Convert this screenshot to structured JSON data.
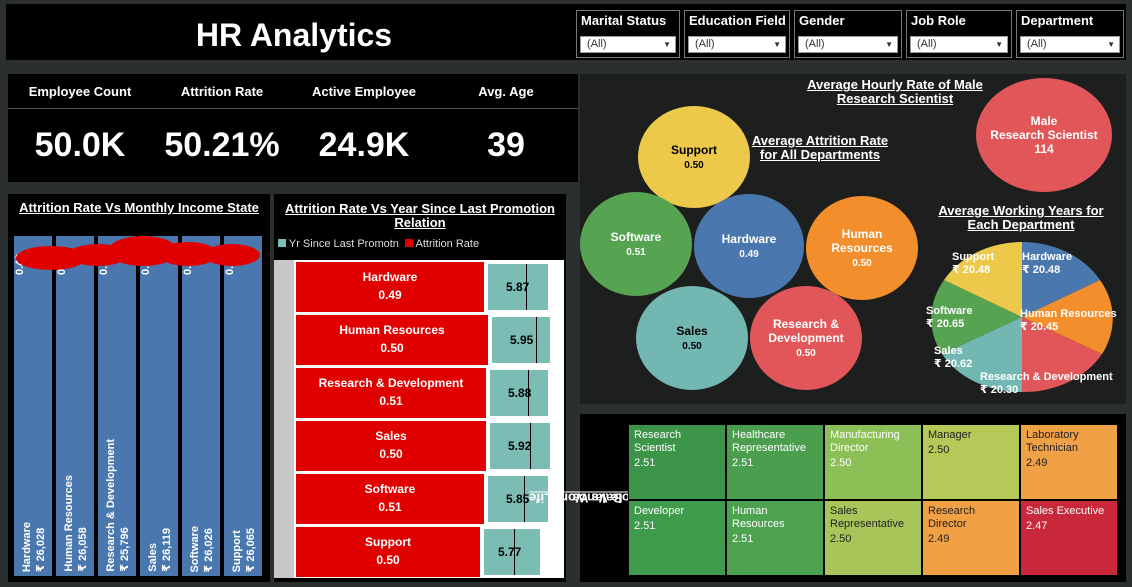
{
  "title": "HR Analytics",
  "filters": [
    {
      "label": "Marital Status",
      "value": "(All)"
    },
    {
      "label": "Education Field",
      "value": "(All)"
    },
    {
      "label": "Gender",
      "value": "(All)"
    },
    {
      "label": "Job Role",
      "value": "(All)"
    },
    {
      "label": "Department",
      "value": "(All)"
    }
  ],
  "kpis": [
    {
      "label": "Employee Count",
      "value": "50.0K"
    },
    {
      "label": "Attrition Rate",
      "value": "50.21%"
    },
    {
      "label": "Active Employee",
      "value": "24.9K"
    },
    {
      "label": "Avg. Age",
      "value": "39"
    }
  ],
  "income_chart": {
    "title": "Attrition Rate Vs Monthly Income State",
    "bars": [
      {
        "category": "Hardware",
        "income": "₹ 26,028",
        "rate": "0.49"
      },
      {
        "category": "Human Resources",
        "income": "₹ 26,058",
        "rate": "0.50"
      },
      {
        "category": "Research & Development",
        "income": "₹ 25,796",
        "rate": "0.51"
      },
      {
        "category": "Sales",
        "income": "₹ 26,119",
        "rate": "0.50"
      },
      {
        "category": "Software",
        "income": "₹ 26,026",
        "rate": "0.51"
      },
      {
        "category": "Support",
        "income": "₹ 26,065",
        "rate": "0.50"
      }
    ]
  },
  "promo_chart": {
    "title_line1": "Attrition Rate Vs Year Since Last Promotion",
    "title_line2": "Relation",
    "legend": {
      "teal": "Yr Since Last Promotn",
      "red": "Attrition Rate"
    },
    "colors": {
      "teal": "#7bbdb5",
      "red": "#e00000"
    },
    "rows": [
      {
        "category": "Hardware",
        "rate": "0.49",
        "years": "5.87"
      },
      {
        "category": "Human Resources",
        "rate": "0.50",
        "years": "5.95"
      },
      {
        "category": "Research & Development",
        "rate": "0.51",
        "years": "5.88"
      },
      {
        "category": "Sales",
        "rate": "0.50",
        "years": "5.92"
      },
      {
        "category": "Software",
        "rate": "0.51",
        "years": "5.85"
      },
      {
        "category": "Support",
        "rate": "0.50",
        "years": "5.77"
      }
    ]
  },
  "hourly": {
    "title_line1": "Average Hourly Rate of Male",
    "title_line2": "Research Scientist",
    "label1": "Male",
    "label2": "Research Scientist",
    "value": "114"
  },
  "dept_attrition": {
    "title_line1": "Average Attrition Rate",
    "title_line2": "for All Departments",
    "bubbles": [
      {
        "name": "Support",
        "value": "0.50",
        "color": "#ecc94b"
      },
      {
        "name": "Software",
        "value": "0.51",
        "color": "#56a352"
      },
      {
        "name": "Hardware",
        "value": "0.49",
        "color": "#4a78ae"
      },
      {
        "name": "Human Resources",
        "value": "0.50",
        "color": "#f28e2b"
      },
      {
        "name": "Sales",
        "value": "0.50",
        "color": "#72b7b2"
      },
      {
        "name": "Research & Development",
        "value": "0.50",
        "color": "#e15759"
      }
    ]
  },
  "working_years": {
    "title_line1": "Average Working Years for",
    "title_line2": "Each Department",
    "slices": [
      {
        "name": "Hardware",
        "value": "₹ 20.48",
        "color": "#4a78ae"
      },
      {
        "name": "Human Resources",
        "value": "₹ 20.45",
        "color": "#f28e2b"
      },
      {
        "name": "Research & Development",
        "value": "₹ 20.30",
        "color": "#e15759"
      },
      {
        "name": "Sales",
        "value": "₹ 20.62",
        "color": "#72b7b2"
      },
      {
        "name": "Software",
        "value": "₹ 20.65",
        "color": "#56a352"
      },
      {
        "name": "Support",
        "value": "₹ 20.48",
        "color": "#ecc94b"
      }
    ]
  },
  "heatmap": {
    "title_line1": "Job Role Vs Work Life",
    "title_line2": "Balance",
    "cells": [
      {
        "role": "Research Scientist",
        "value": "2.51",
        "color": "#3b9448"
      },
      {
        "role": "Healthcare Representative",
        "value": "2.51",
        "color": "#4a9e4e"
      },
      {
        "role": "Manufacturing Director",
        "value": "2.50",
        "color": "#8cbf56"
      },
      {
        "role": "Manager",
        "value": "2.50",
        "color": "#b6c857"
      },
      {
        "role": "Laboratory Technician",
        "value": "2.49",
        "color": "#f0a045"
      },
      {
        "role": "Developer",
        "value": "2.51",
        "color": "#3f9a4b"
      },
      {
        "role": "Human Resources",
        "value": "2.51",
        "color": "#4ca24f"
      },
      {
        "role": "Sales Representative",
        "value": "2.50",
        "color": "#a8c55a"
      },
      {
        "role": "Research Director",
        "value": "2.49",
        "color": "#f2a044"
      },
      {
        "role": "Sales Executive",
        "value": "2.47",
        "color": "#c8283a"
      }
    ]
  }
}
